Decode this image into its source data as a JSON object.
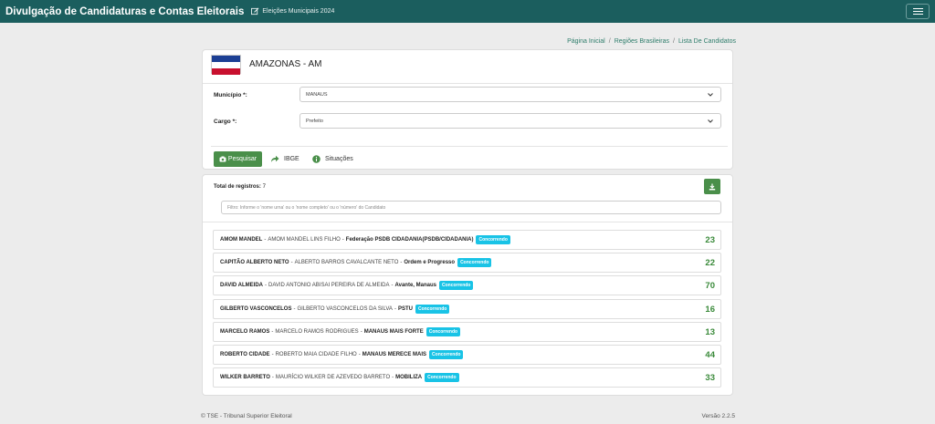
{
  "header": {
    "title": "Divulgação de Candidaturas e Contas Eleitorais",
    "subtitle": "Eleições Municipais 2024"
  },
  "breadcrumb": [
    "Página Inicial",
    "Regiões Brasileiras",
    "Lista De Candidatos"
  ],
  "state": {
    "name": "AMAZONAS - AM"
  },
  "form": {
    "municipio_label": "Município *:",
    "municipio_value": "MANAUS",
    "cargo_label": "Cargo *:",
    "cargo_value": "Prefeito",
    "search_label": "Pesquisar",
    "ibge_label": "IBGE",
    "situacoes_label": "Situações"
  },
  "results": {
    "total_label": "Total de registros:",
    "total_value": "7",
    "filter_placeholder": "Filtro: Informe o 'nome urna' ou o 'nome completo' ou o 'número' do Candidato",
    "candidates": [
      {
        "urna": "AMOM MANDEL",
        "completo": "AMOM MANDEL LINS FILHO",
        "partido": "Federação PSDB CIDADANIA(PSDB/CIDADANIA)",
        "status": "Concorrendo",
        "numero": "23"
      },
      {
        "urna": "CAPITÃO ALBERTO NETO",
        "completo": "ALBERTO BARROS CAVALCANTE NETO",
        "partido": "Ordem e Progresso",
        "status": "Concorrendo",
        "numero": "22"
      },
      {
        "urna": "DAVID ALMEIDA",
        "completo": "DAVID ANTONIO ABISAI PEREIRA DE ALMEIDA",
        "partido": "Avante, Manaus",
        "status": "Concorrendo",
        "numero": "70"
      },
      {
        "urna": "GILBERTO VASCONCELOS",
        "completo": "GILBERTO VASCONCELOS DA SILVA",
        "partido": "PSTU",
        "status": "Concorrendo",
        "numero": "16"
      },
      {
        "urna": "MARCELO RAMOS",
        "completo": "MARCELO RAMOS RODRIGUES",
        "partido": "MANAUS MAIS FORTE",
        "status": "Concorrendo",
        "numero": "13"
      },
      {
        "urna": "ROBERTO CIDADE",
        "completo": "ROBERTO MAIA CIDADE FILHO",
        "partido": "MANAUS MERECE MAIS",
        "status": "Concorrendo",
        "numero": "44"
      },
      {
        "urna": "WILKER BARRETO",
        "completo": "MAURÍCIO WILKER DE AZEVEDO BARRETO",
        "partido": "MOBILIZA",
        "status": "Concorrendo",
        "numero": "33"
      }
    ]
  },
  "footer": {
    "left": "© TSE - Tribunal Superior Eleitoral",
    "right": "Versão 2.2.5"
  },
  "colors": {
    "topbar": "#1b5e5e",
    "accent_green": "#4a8f4a",
    "badge": "#19c3e6"
  }
}
